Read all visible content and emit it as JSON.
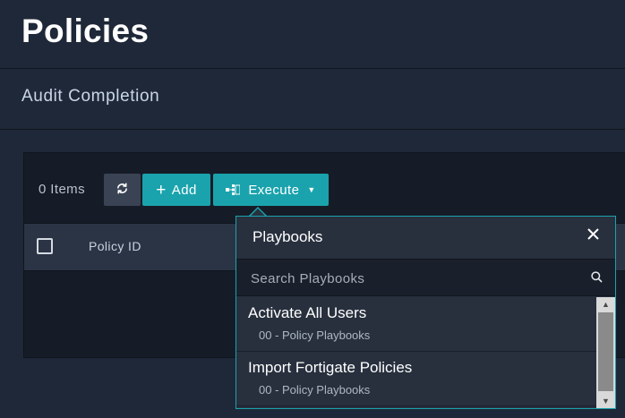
{
  "page": {
    "title": "Policies"
  },
  "section": {
    "title": "Audit Completion"
  },
  "toolbar": {
    "items_count": "0 Items",
    "refresh_icon": "refresh-icon",
    "add_label": "Add",
    "execute_label": "Execute",
    "accent_color": "#1aa3ad"
  },
  "table": {
    "columns": [
      "Policy ID"
    ]
  },
  "playbooks": {
    "title": "Playbooks",
    "search_placeholder": "Search Playbooks",
    "items": [
      {
        "name": "Activate All Users",
        "collection": "00 - Policy Playbooks"
      },
      {
        "name": "Import Fortigate Policies",
        "collection": "00 - Policy Playbooks"
      }
    ]
  }
}
